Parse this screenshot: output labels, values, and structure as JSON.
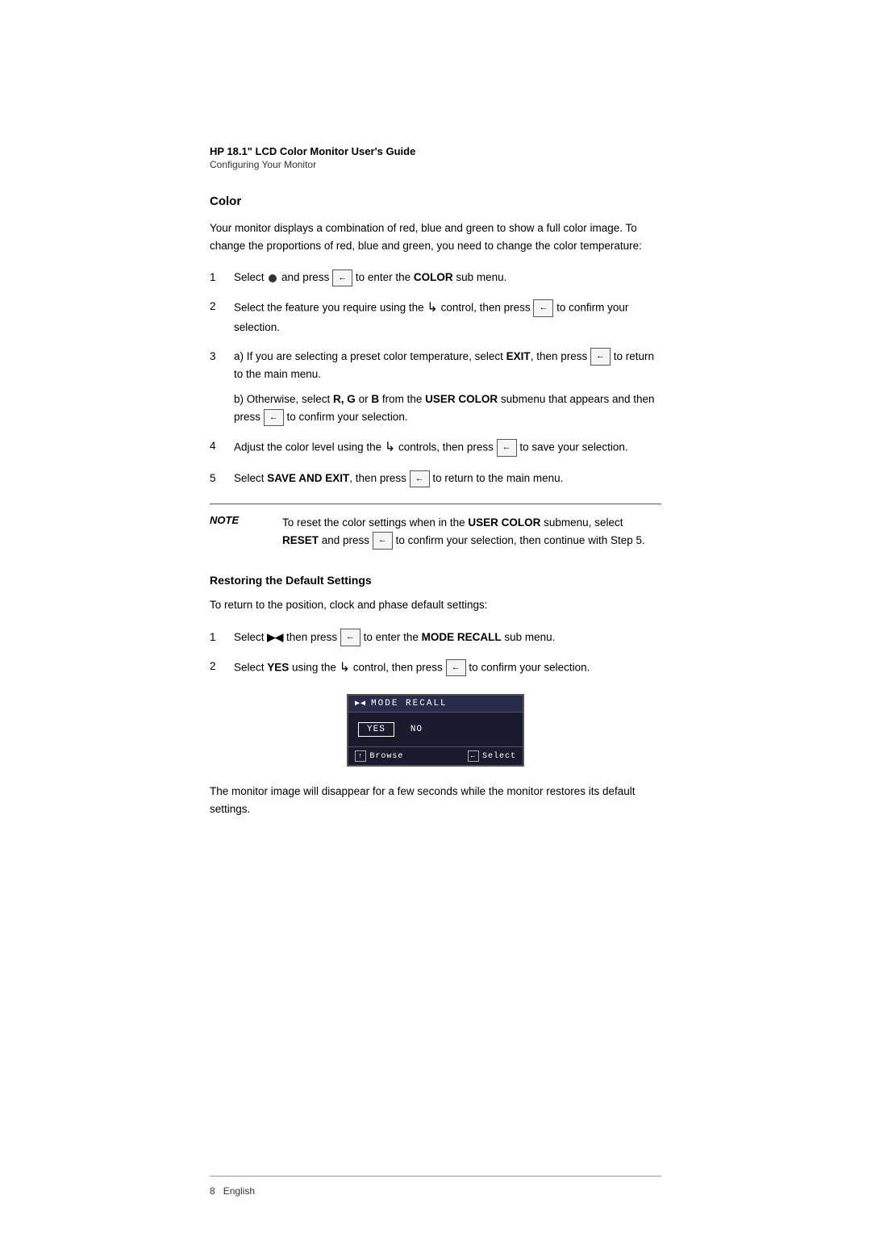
{
  "header": {
    "title": "HP 18.1\" LCD Color Monitor User's Guide",
    "subtitle": "Configuring Your Monitor"
  },
  "color_section": {
    "title": "Color",
    "intro": "Your monitor displays a combination of red, blue and green to show a full color image. To change the proportions of red, blue and green, you need to change the color temperature:",
    "steps": [
      {
        "num": "1",
        "text_before": "Select",
        "icon": "circle",
        "text_mid": "and press",
        "kbd": "←",
        "text_after": "to enter the",
        "bold": "COLOR",
        "text_end": "sub menu."
      },
      {
        "num": "2",
        "text_before": "Select the feature you require using the",
        "curve": "↙",
        "text_mid": "control, then press",
        "kbd": "←",
        "text_after": "to confirm your selection."
      },
      {
        "num": "3",
        "part_a": "a) If you are selecting a preset color temperature, select EXIT, then press",
        "part_a2": "to return to the main menu.",
        "part_b": "b) Otherwise, select R, G or B from the USER COLOR submenu that appears and then press",
        "part_b2": "to confirm your selection."
      },
      {
        "num": "4",
        "text_before": "Adjust the color level using the",
        "curve": "↙",
        "text_mid": "controls, then press",
        "kbd": "←",
        "text_after": "to save your selection."
      },
      {
        "num": "5",
        "text_before": "Select",
        "bold": "SAVE AND EXIT",
        "text_mid": ", then press",
        "kbd": "←",
        "text_after": "to return to the main menu."
      }
    ]
  },
  "note": {
    "label": "NOTE",
    "text": "To reset the color settings when in the USER COLOR submenu, select RESET and press",
    "text2": "to confirm your selection, then continue with Step 5."
  },
  "restore_section": {
    "title": "Restoring the Default Settings",
    "intro": "To return to the position, clock and phase default settings:",
    "steps": [
      {
        "num": "1",
        "text_before": "Select",
        "icon": "skip",
        "text_mid": "then press",
        "kbd": "←",
        "text_after": "to enter the",
        "bold": "MODE RECALL",
        "text_end": "sub menu."
      },
      {
        "num": "2",
        "text_before": "Select",
        "bold": "YES",
        "text_mid": "using the",
        "curve": "↙",
        "text_after": "control, then press",
        "kbd": "←",
        "text_end": "to confirm your selection."
      }
    ]
  },
  "osd_menu": {
    "title": "MODE RECALL",
    "title_icon": "⊳⊲",
    "yes_label": "YES",
    "no_label": "NO",
    "browse_label": "Browse",
    "select_label": "Select",
    "browse_icon": "↑",
    "select_icon": "←"
  },
  "closing_text": "The monitor image will disappear for a few seconds while the monitor restores its default settings.",
  "footer": {
    "page": "8",
    "lang": "English"
  }
}
